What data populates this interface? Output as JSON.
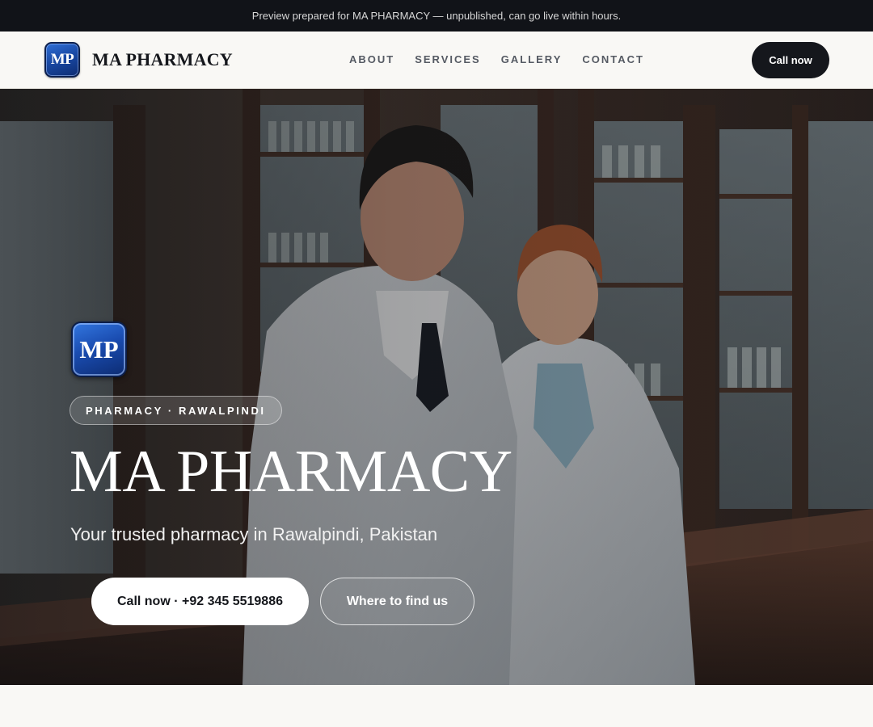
{
  "preview_bar": {
    "text": "Preview prepared for MA PHARMACY — unpublished, can go live within hours."
  },
  "header": {
    "logo_text": "MP",
    "brand_name": "MA PHARMACY",
    "nav": [
      {
        "label": "ABOUT"
      },
      {
        "label": "SERVICES"
      },
      {
        "label": "GALLERY"
      },
      {
        "label": "CONTACT"
      }
    ],
    "call_button": "Call now"
  },
  "hero": {
    "logo_text": "MP",
    "tag": "PHARMACY · RAWALPINDI",
    "title": "MA PHARMACY",
    "subtitle": "Your trusted pharmacy in Rawalpindi, Pakistan",
    "primary_button": "Call now · +92 345 5519886",
    "secondary_button": "Where to find us",
    "image_icon": "pharmacists-photo"
  },
  "colors": {
    "dark": "#15171c",
    "page_bg": "#f9f8f5",
    "logo_blue": "#1a4aa6"
  }
}
